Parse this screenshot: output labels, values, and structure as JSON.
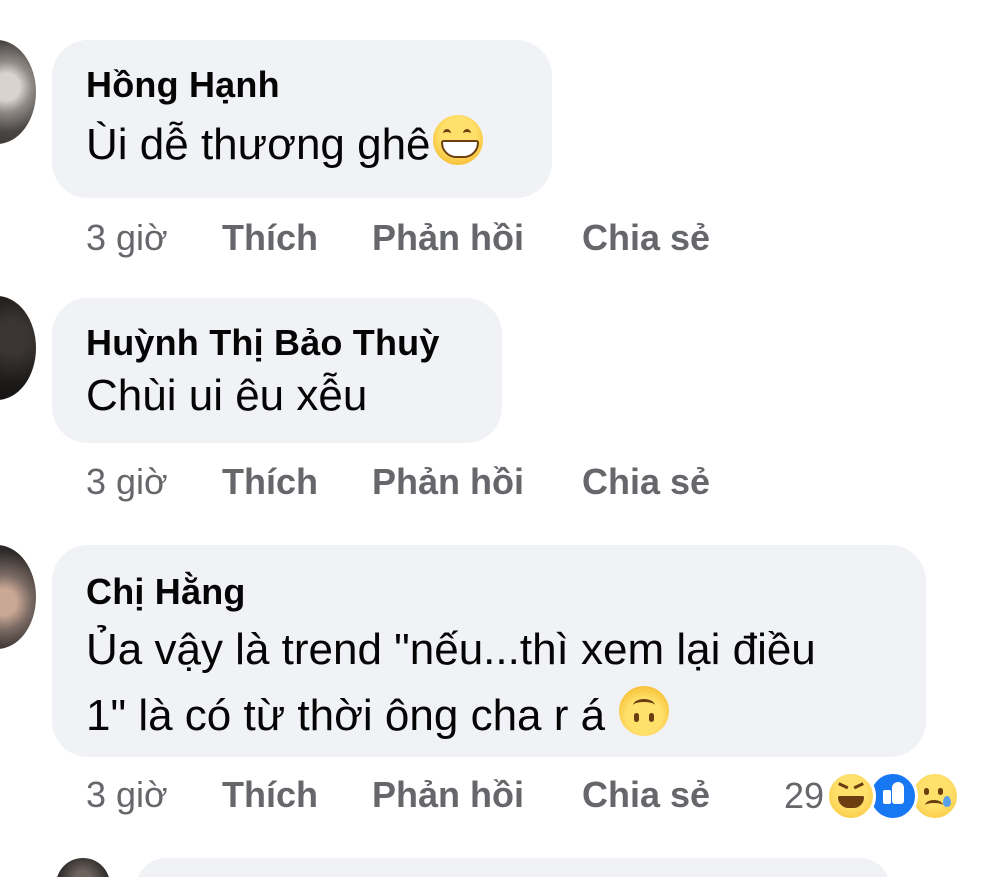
{
  "comments": [
    {
      "author": "Hồng Hạnh",
      "text": "Ùi dễ thương ghê",
      "emoji": "grinning-face-icon",
      "time": "3 giờ",
      "like_label": "Thích",
      "reply_label": "Phản hồi",
      "share_label": "Chia sẻ"
    },
    {
      "author": "Huỳnh Thị Bảo Thuỳ",
      "text": "Chùi ui êu xễu",
      "time": "3 giờ",
      "like_label": "Thích",
      "reply_label": "Phản hồi",
      "share_label": "Chia sẻ"
    },
    {
      "author": "Chị Hằng",
      "text_line1": "Ủa vậy là trend  \"nếu...thì xem lại điều",
      "text_line2": "1\"  là có từ thời ông cha r á",
      "emoji": "upside-down-face-icon",
      "time": "3 giờ",
      "like_label": "Thích",
      "reply_label": "Phản hồi",
      "share_label": "Chia sẻ",
      "reaction_count": "29",
      "reactions": [
        "haha-reaction-icon",
        "like-reaction-icon",
        "sad-reaction-icon"
      ]
    }
  ],
  "colors": {
    "bubble_bg": "#f0f2f5",
    "text": "#050505",
    "meta": "#65676b",
    "like_blue": "#1877f2"
  }
}
